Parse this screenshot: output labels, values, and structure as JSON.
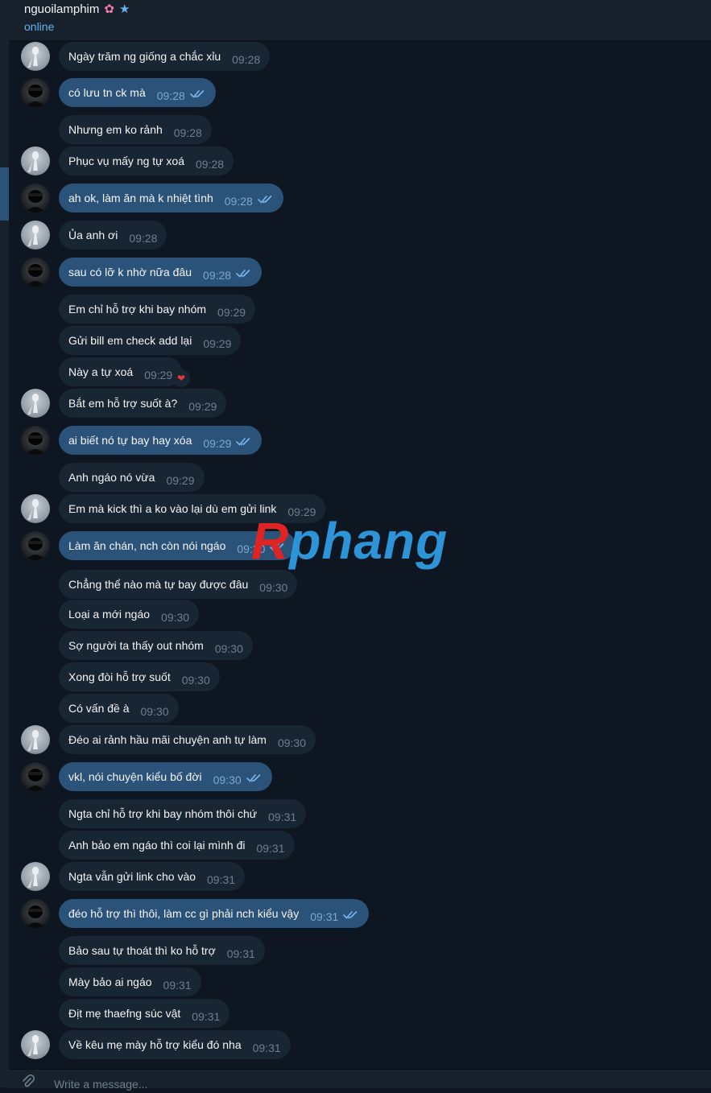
{
  "header": {
    "contact_name": "nguoilamphim",
    "status": "online"
  },
  "composer": {
    "placeholder": "Write a message..."
  },
  "watermark": {
    "part1": "R",
    "part2": "phang"
  },
  "reaction": "❤",
  "messages": [
    {
      "dir": "in",
      "avatar": true,
      "text": "Ngày trăm ng giống a chắc xỉu",
      "time": "09:28"
    },
    {
      "dir": "out",
      "avatar": true,
      "text": "có lưu tn ck mà",
      "time": "09:28"
    },
    {
      "dir": "in",
      "avatar": false,
      "text": "Nhưng em ko rảnh",
      "time": "09:28"
    },
    {
      "dir": "in",
      "avatar": true,
      "text": "Phục vụ mấy ng tự xoá",
      "time": "09:28"
    },
    {
      "dir": "out",
      "avatar": true,
      "text": "ah ok, làm ăn mà k nhiệt tình",
      "time": "09:28"
    },
    {
      "dir": "in",
      "avatar": true,
      "text": "Ủa anh ơi",
      "time": "09:28"
    },
    {
      "dir": "out",
      "avatar": true,
      "text": "sau có lỡ k nhờ nữa đâu",
      "time": "09:28"
    },
    {
      "dir": "in",
      "avatar": false,
      "text": "Em chỉ hỗ trợ khi bay nhóm",
      "time": "09:29"
    },
    {
      "dir": "in",
      "avatar": false,
      "text": "Gửi bill em check add lại",
      "time": "09:29"
    },
    {
      "dir": "in",
      "avatar": false,
      "text": "Này a tự xoá",
      "time": "09:29",
      "reaction": true
    },
    {
      "dir": "in",
      "avatar": true,
      "text": "Bắt em hỗ trợ suốt à?",
      "time": "09:29"
    },
    {
      "dir": "out",
      "avatar": true,
      "text": "ai biết nó tự bay hay xóa",
      "time": "09:29"
    },
    {
      "dir": "in",
      "avatar": false,
      "text": "Anh ngáo nó vừa",
      "time": "09:29"
    },
    {
      "dir": "in",
      "avatar": true,
      "text": "Em mà kick thì a ko vào lại dù em gửi link",
      "time": "09:29"
    },
    {
      "dir": "out",
      "avatar": true,
      "text": "Làm ăn chán, nch còn nói ngáo",
      "time": "09:30"
    },
    {
      "dir": "in",
      "avatar": false,
      "text": "Chẳng thể nào mà tự bay được đâu",
      "time": "09:30"
    },
    {
      "dir": "in",
      "avatar": false,
      "text": "Loại a mới ngáo",
      "time": "09:30"
    },
    {
      "dir": "in",
      "avatar": false,
      "text": "Sợ người ta thấy out nhóm",
      "time": "09:30"
    },
    {
      "dir": "in",
      "avatar": false,
      "text": "Xong đòi hỗ trợ suốt",
      "time": "09:30"
    },
    {
      "dir": "in",
      "avatar": false,
      "text": "Có vấn đề à",
      "time": "09:30"
    },
    {
      "dir": "in",
      "avatar": true,
      "text": "Đéo ai rảnh hầu mãi chuyện anh tự làm",
      "time": "09:30"
    },
    {
      "dir": "out",
      "avatar": true,
      "text": "vkl, nói chuyện kiểu bố đời",
      "time": "09:30"
    },
    {
      "dir": "in",
      "avatar": false,
      "text": "Ngta chỉ hỗ trợ khi bay nhóm thôi chứ",
      "time": "09:31"
    },
    {
      "dir": "in",
      "avatar": false,
      "text": "Anh bảo em ngáo thì coi lại mình đi",
      "time": "09:31"
    },
    {
      "dir": "in",
      "avatar": true,
      "text": "Ngta vẫn gửi link cho vào",
      "time": "09:31"
    },
    {
      "dir": "out",
      "avatar": true,
      "text": "đéo hỗ trợ thì thôi, làm cc gì phải nch kiểu vậy",
      "time": "09:31"
    },
    {
      "dir": "in",
      "avatar": false,
      "text": "Bảo sau tự thoát thì ko hỗ trợ",
      "time": "09:31"
    },
    {
      "dir": "in",
      "avatar": false,
      "text": "Mày bảo ai ngáo",
      "time": "09:31"
    },
    {
      "dir": "in",
      "avatar": false,
      "text": "Địt mẹ thaefng súc vật",
      "time": "09:31"
    },
    {
      "dir": "in",
      "avatar": true,
      "text": "Về kêu mẹ mày hỗ trợ kiểu đó nha",
      "time": "09:31"
    }
  ]
}
